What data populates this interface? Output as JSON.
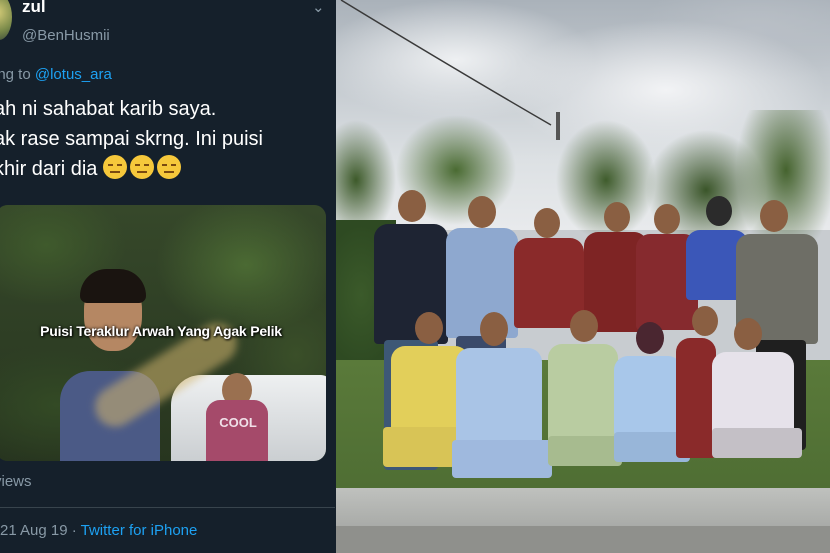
{
  "tweet": {
    "display_name": "zul",
    "handle": "@BenHusmii",
    "replying_prefix": "ing to ",
    "replying_to": "@lotus_ara",
    "text_line1": "ah ni sahabat karib saya.",
    "text_line2": "ak rase sampai skrng. Ini puisi",
    "text_line3": "khir dari dia ",
    "emoji_icons": [
      "pensive-face-icon",
      "pensive-face-icon",
      "pensive-face-icon"
    ],
    "views_label": "views",
    "date": "21 Aug 19",
    "separator": " · ",
    "source": "Twitter for iPhone"
  },
  "video": {
    "caption": "Puisi Teraklur Arwah Yang Agak Pelik",
    "shirt_text": "COOL"
  },
  "photo": {
    "subject": "group-photo"
  }
}
